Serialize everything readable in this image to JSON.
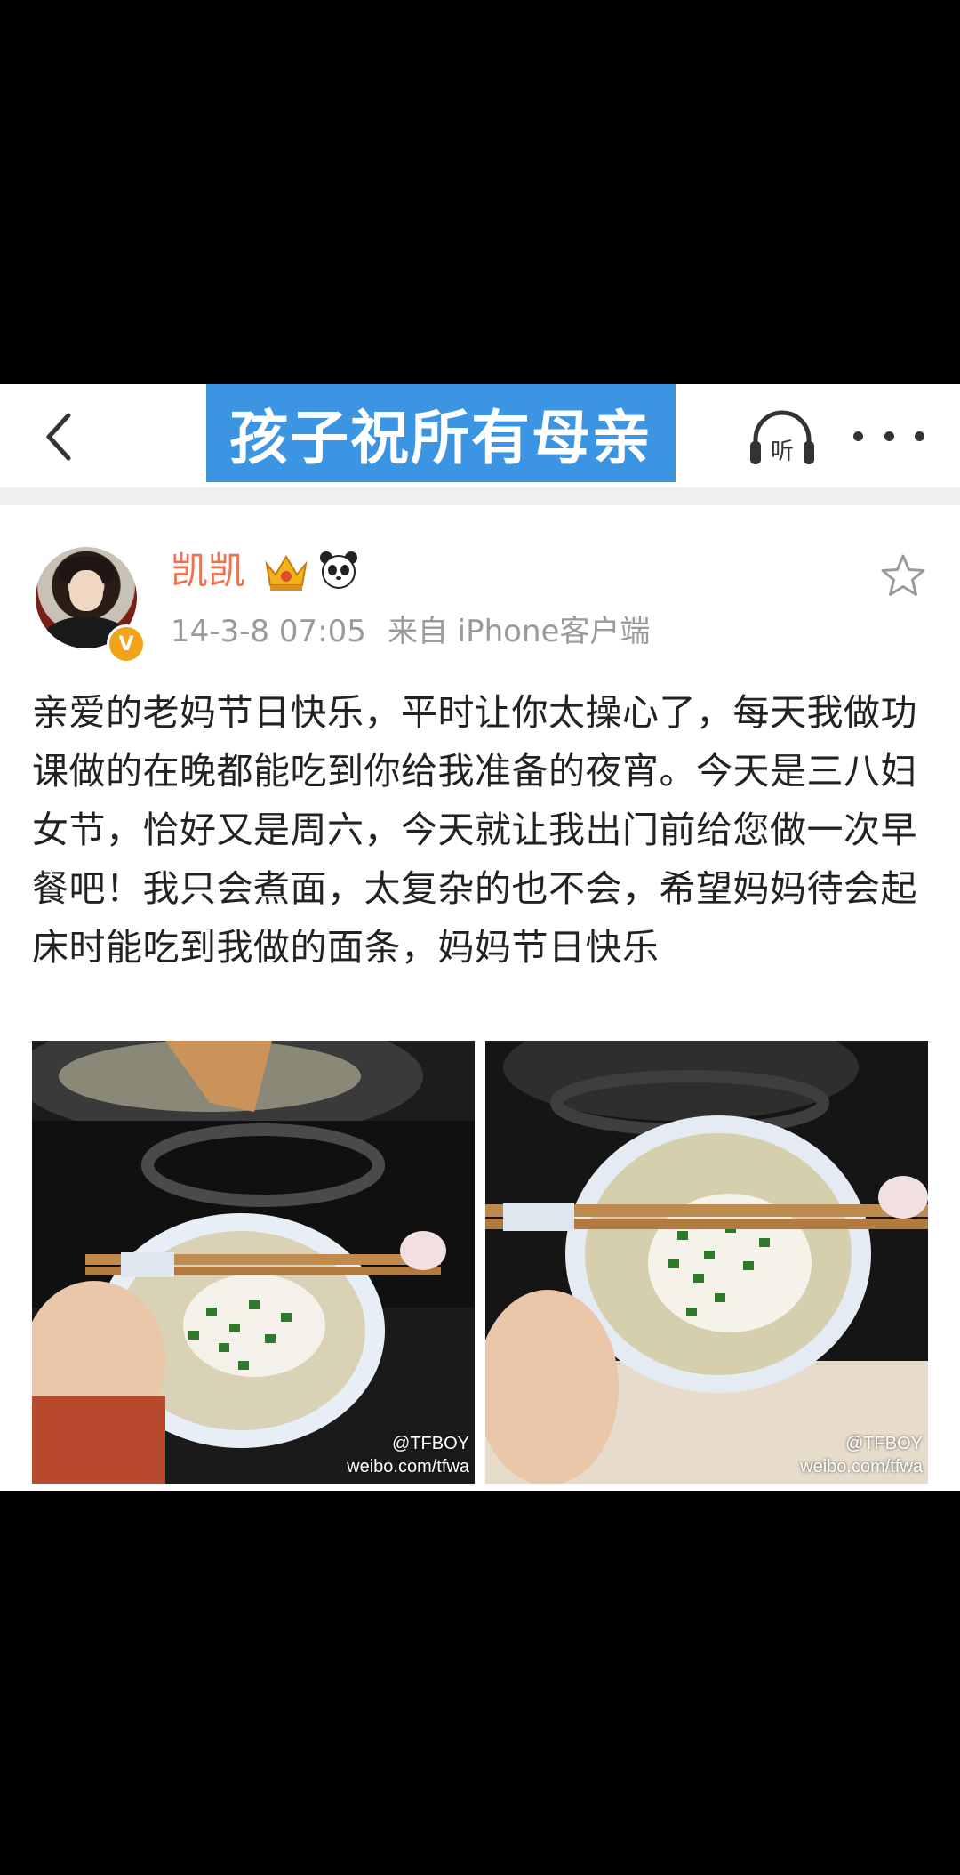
{
  "nav": {
    "title": "孩子祝所有母亲",
    "back_icon": "chevron-left-icon",
    "listen_label": "听",
    "listen_icon": "headphones-icon",
    "more_icon": "more-dots-icon",
    "title_bg": "#3c95e3"
  },
  "post": {
    "username": "凯凯",
    "username_color": "#eb7350",
    "badges": [
      "crown-icon",
      "panda-icon"
    ],
    "verified_icon": "verified-badge-icon",
    "timestamp": "14-3-8 07:05",
    "source": "来自 iPhone客户端",
    "favorite_icon": "star-outline-icon",
    "text": "亲爱的老妈节日快乐，平时让你太操心了，每天我做功课做的在晚都能吃到你给我准备的夜宵。今天是三八妇女节，恰好又是周六，今天就让我出门前给您做一次早餐吧！我只会煮面，太复杂的也不会，希望妈妈待会起床时能吃到我做的面条，妈妈节日快乐",
    "photos": [
      {
        "description_icon": "noodle-bowl-photo",
        "watermark_handle": "@TFBOY",
        "watermark_url": "weibo.com/tfwa"
      },
      {
        "description_icon": "noodle-bowl-photo",
        "watermark_handle": "@TFBOY",
        "watermark_url": "weibo.com/tfwa"
      }
    ]
  }
}
